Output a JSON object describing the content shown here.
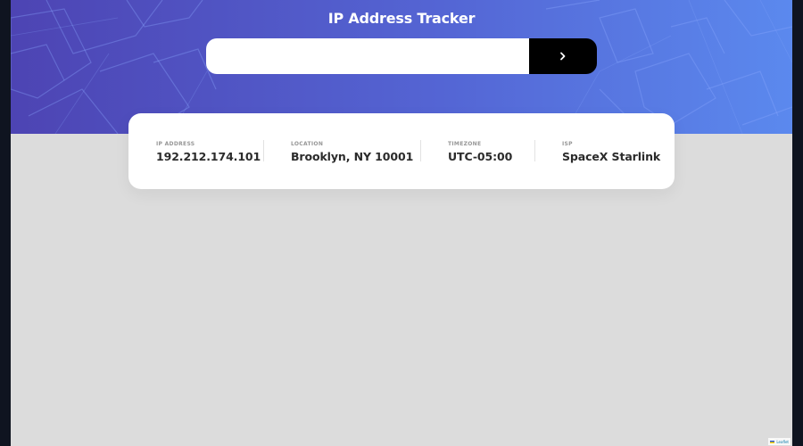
{
  "header": {
    "title": "IP Address Tracker"
  },
  "search": {
    "value": "",
    "placeholder": "",
    "button_icon": "chevron-right-icon"
  },
  "info": {
    "ip": {
      "label": "IP ADDRESS",
      "value": "192.212.174.101"
    },
    "location": {
      "label": "LOCATION",
      "value": "Brooklyn, NY 10001"
    },
    "timezone": {
      "label": "TIMEZONE",
      "value": "UTC-05:00"
    },
    "isp": {
      "label": "ISP",
      "value": "SpaceX Starlink"
    }
  },
  "map": {
    "attribution": "Leaflet"
  },
  "colors": {
    "header_gradient_start": "#4d44b3",
    "header_gradient_end": "#5b89ee",
    "button": "#000000",
    "value_text": "#2b2b2b",
    "label_text": "#969696",
    "map_background": "#dcdcdc"
  }
}
